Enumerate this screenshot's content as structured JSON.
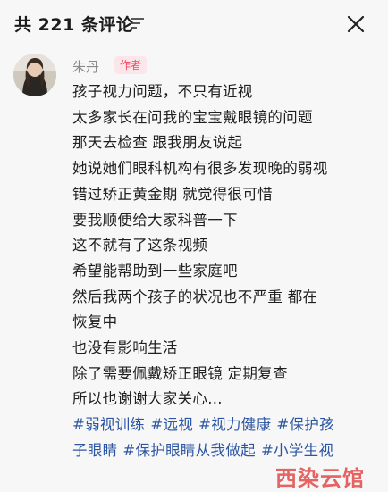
{
  "header": {
    "prefix": "共 ",
    "count": "221",
    "suffix": " 条评论"
  },
  "comment": {
    "author": "朱丹",
    "badge": "作者",
    "lines": [
      "孩子视力问题，不只有近视",
      "太多家长在问我的宝宝戴眼镜的问题",
      "那天去检查 跟我朋友说起",
      "她说她们眼科机构有很多发现晚的弱视",
      "错过矫正黄金期 就觉得很可惜",
      "要我顺便给大家科普一下",
      "这不就有了这条视频",
      "希望能帮助到一些家庭吧",
      "然后我两个孩子的状况也不严重 都在",
      "恢复中",
      "也没有影响生活",
      "除了需要佩戴矫正眼镜 定期复查",
      "所以也谢谢大家关心..."
    ],
    "tags_line1": [
      "#弱视训练",
      "#远视",
      "#视力健康",
      "#保护孩"
    ],
    "tags_line2": [
      "子眼睛",
      "#保护眼睛从我做起",
      "#小学生视"
    ]
  },
  "watermark": {
    "text": "西染云馆"
  },
  "colors": {
    "badge_bg": "#fde6ea",
    "badge_text": "#f0475f",
    "tag": "#2c56a3",
    "watermark": "#e24a4a"
  },
  "icons": {
    "sort": "sort-icon",
    "close": "close-icon"
  }
}
